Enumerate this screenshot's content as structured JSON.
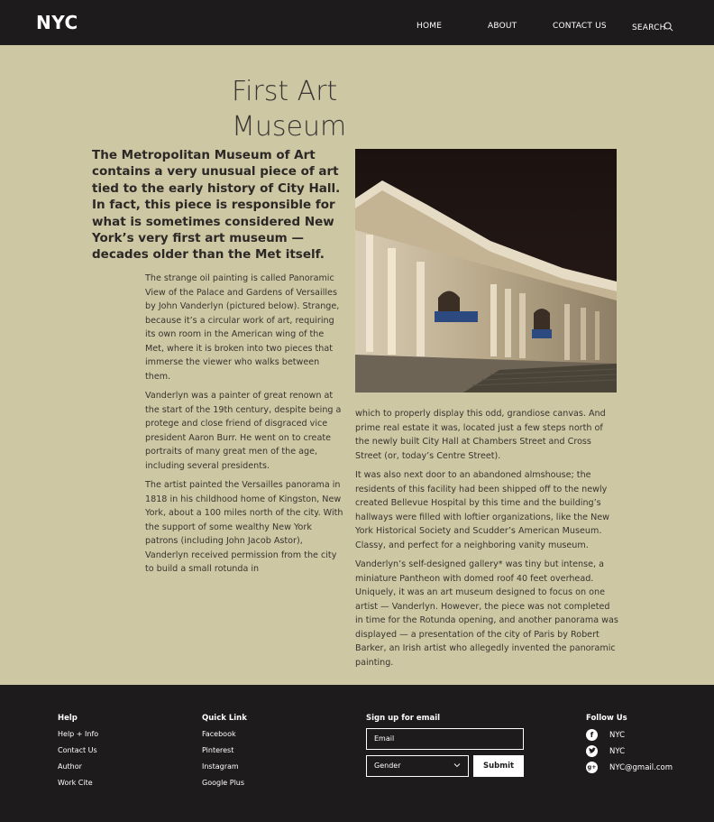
{
  "header": {
    "logo": "NYC",
    "nav": {
      "home": "HOME",
      "about": "ABOUT",
      "contact": "CONTACT US",
      "search": "SEARCH"
    }
  },
  "article": {
    "title_line1": "First Art",
    "title_line2": "Museum",
    "lead": "The Metropolitan Museum of Art contains a very unusual piece of art tied to the early history of City Hall. In fact, this piece is responsible for what is sometimes considered New York’s very first art museum — decades older than the Met itself.",
    "left_paragraphs": [
      "The strange oil painting is called Panoramic View of the Palace and Gardens of Versailles by John Vanderlyn (pictured below). Strange, because it’s a circular work of art, requiring its own room in the American wing of the Met, where it is broken into two pieces that immerse the viewer who walks between them.",
      "Vanderlyn was a painter of great renown at the start of the 19th century, despite being a protege and close friend of disgraced vice president Aaron Burr. He went on to create portraits of many great men of the age, including several presidents.",
      "The artist painted the Versailles panorama in 1818 in his childhood home of Kingston, New York, about a 100 miles north of the city. With the support of some wealthy New York patrons (including John Jacob Astor), Vanderlyn received permission from the city to build a small rotunda in"
    ],
    "right_paragraphs": [
      "which to properly display this odd, grandiose canvas. And prime real estate it was, located just a few steps north of the newly built City Hall at Chambers Street and Cross Street (or, today’s Centre Street).",
      "It was also next door to an abandoned almshouse; the residents of this facility had been shipped off to the newly created Bellevue Hospital by this time and the building’s hallways were filled with loftier organizations, like the New York Historical Society and Scudder’s American Museum. Classy, and perfect for a neighboring vanity museum.",
      "Vanderlyn’s self-designed gallery* was tiny but intense, a miniature Pantheon with domed roof 40 feet overhead. Uniquely, it was an art museum designed to focus on one artist — Vanderlyn. However, the piece was not completed in time for the Rotunda opening, and another panorama was displayed — a presentation of the city of Paris by Robert Barker, an Irish artist who allegedly invented the panoramic painting."
    ]
  },
  "footer": {
    "help": {
      "heading": "Help",
      "links": [
        "Help + Info",
        "Contact Us",
        "Author",
        "Work Cite"
      ]
    },
    "quick": {
      "heading": "Quick Link",
      "links": [
        "Facebook",
        "Pinterest",
        "Instagram",
        "Google Plus"
      ]
    },
    "signup": {
      "heading": "Sign up for email",
      "email_placeholder": "Email",
      "gender_value": "Gender",
      "submit": "Submit"
    },
    "follow": {
      "heading": "Follow Us",
      "items": [
        {
          "icon": "facebook-icon",
          "label": "NYC"
        },
        {
          "icon": "twitter-icon",
          "label": "NYC"
        },
        {
          "icon": "google-plus-icon",
          "label": "NYC@gmail.com"
        }
      ]
    }
  },
  "colors": {
    "background": "#cdc7a4",
    "header": "#1d1b1c",
    "text": "#2a2624"
  }
}
